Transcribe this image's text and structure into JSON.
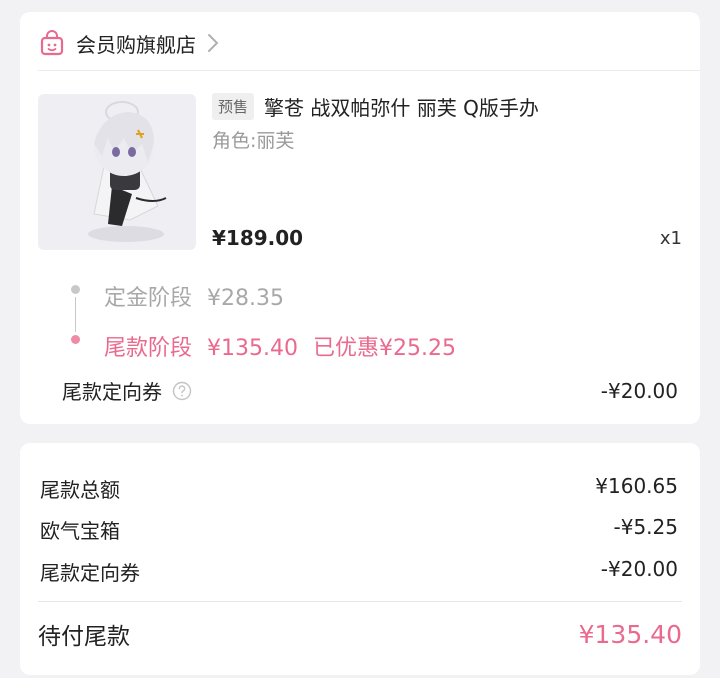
{
  "shop": {
    "name": "会员购旗舰店",
    "icon": "shopping-bag-face-icon"
  },
  "product": {
    "tag": "预售",
    "title": "擎苍 战双帕弥什 丽芙 Q版手办",
    "variant": "角色:丽芙",
    "price": "¥189.00",
    "quantity": "x1"
  },
  "stages": {
    "deposit": {
      "label": "定金阶段",
      "amount": "¥28.35"
    },
    "balance": {
      "label": "尾款阶段",
      "amount": "¥135.40",
      "discount": "已优惠¥25.25"
    }
  },
  "coupon": {
    "label": "尾款定向券",
    "value": "-¥20.00"
  },
  "summary": {
    "rows": [
      {
        "label": "尾款总额",
        "value": "¥160.65"
      },
      {
        "label": "欧气宝箱",
        "value": "-¥5.25"
      },
      {
        "label": "尾款定向券",
        "value": "-¥20.00"
      }
    ],
    "total_label": "待付尾款",
    "total_value": "¥135.40"
  },
  "colors": {
    "accent_pink": "#ea6a8e",
    "muted_grey": "#a8a8a8"
  }
}
